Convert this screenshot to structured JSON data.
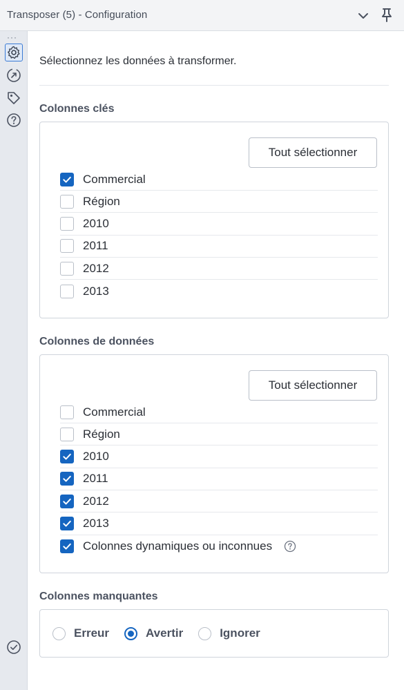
{
  "window": {
    "title": "Transposer (5) - Configuration"
  },
  "rail": {
    "dots": "···",
    "icons": [
      "gear-icon",
      "connection-icon",
      "tag-icon",
      "help-icon"
    ],
    "status_icon": "check-circle-icon"
  },
  "instruction": "Sélectionnez les données à transformer.",
  "key_columns": {
    "title": "Colonnes clés",
    "select_all_label": "Tout sélectionner",
    "items": [
      {
        "label": "Commercial",
        "checked": true
      },
      {
        "label": "Région",
        "checked": false
      },
      {
        "label": "2010",
        "checked": false
      },
      {
        "label": "2011",
        "checked": false
      },
      {
        "label": "2012",
        "checked": false
      },
      {
        "label": "2013",
        "checked": false
      }
    ]
  },
  "data_columns": {
    "title": "Colonnes de données",
    "select_all_label": "Tout sélectionner",
    "items": [
      {
        "label": "Commercial",
        "checked": false
      },
      {
        "label": "Région",
        "checked": false
      },
      {
        "label": "2010",
        "checked": true
      },
      {
        "label": "2011",
        "checked": true
      },
      {
        "label": "2012",
        "checked": true
      },
      {
        "label": "2013",
        "checked": true
      },
      {
        "label": "Colonnes dynamiques ou inconnues",
        "checked": true
      }
    ]
  },
  "missing_columns": {
    "title": "Colonnes manquantes",
    "options": [
      {
        "label": "Erreur",
        "selected": false
      },
      {
        "label": "Avertir",
        "selected": true
      },
      {
        "label": "Ignorer",
        "selected": false
      }
    ]
  },
  "colors": {
    "accent": "#1565c0",
    "rail_background": "#e6e9ee",
    "title_bar": "#f3f4f6"
  }
}
